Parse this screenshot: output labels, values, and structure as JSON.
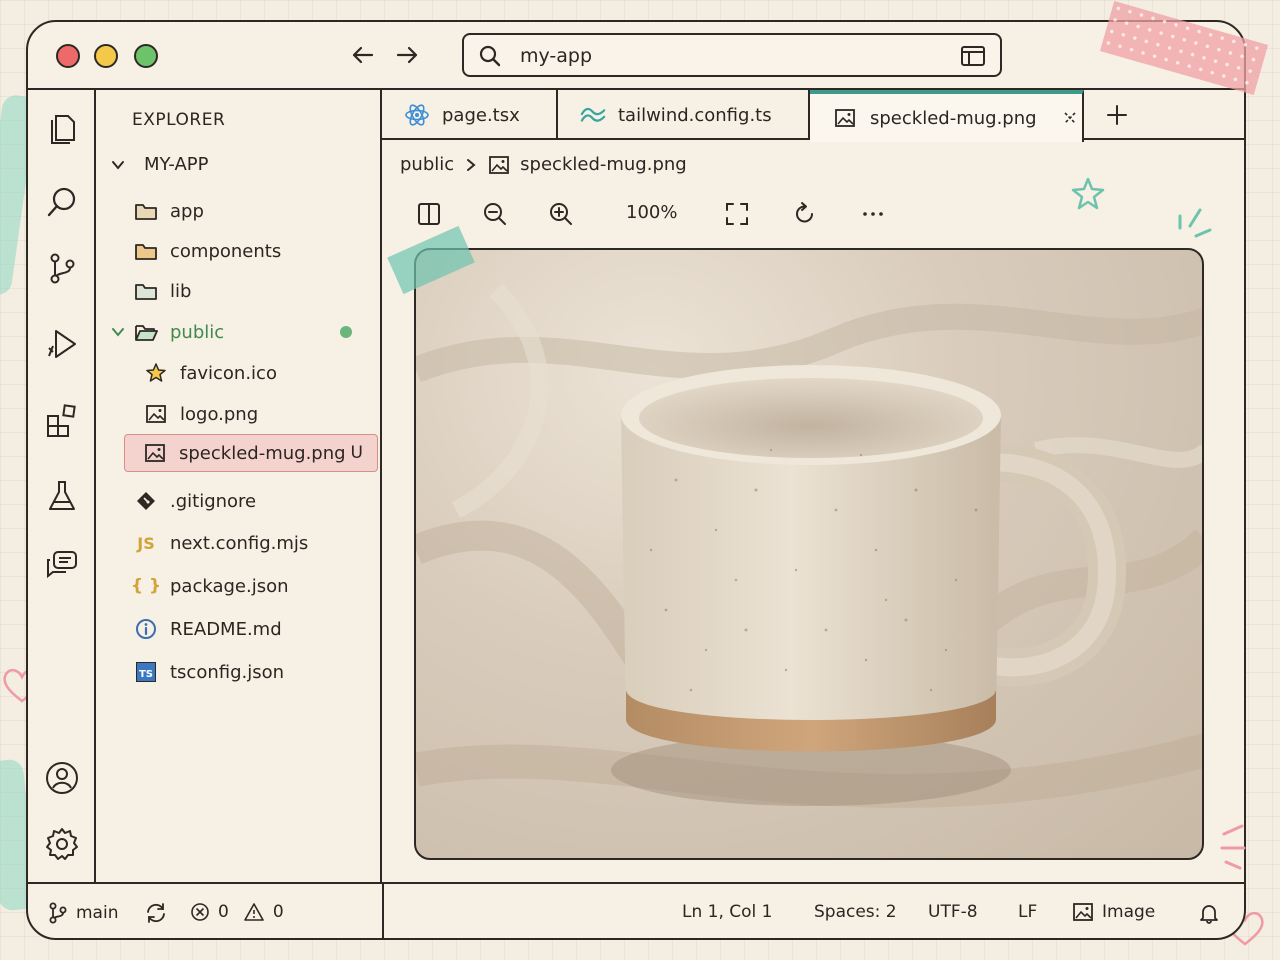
{
  "window": {
    "search": {
      "value": "my-app"
    }
  },
  "sidebar": {
    "title": "EXPLORER",
    "root": "MY-APP",
    "items": [
      {
        "label": "app",
        "icon": "folder-icon"
      },
      {
        "label": "components",
        "icon": "folder-icon"
      },
      {
        "label": "lib",
        "icon": "folder-icon"
      },
      {
        "label": "public",
        "icon": "folder-open-icon"
      },
      {
        "label": "favicon.ico",
        "icon": "star-icon"
      },
      {
        "label": "logo.png",
        "icon": "image-icon"
      },
      {
        "label": "speckled-mug.png",
        "icon": "image-icon",
        "badge": "U"
      },
      {
        "label": ".gitignore",
        "icon": "git-icon"
      },
      {
        "label": "next.config.mjs",
        "icon": "js-icon",
        "icon_text": "JS"
      },
      {
        "label": "package.json",
        "icon": "json-icon",
        "icon_text": "{ }"
      },
      {
        "label": "README.md",
        "icon": "info-icon"
      },
      {
        "label": "tsconfig.json",
        "icon": "ts-icon",
        "icon_text": "TS"
      }
    ]
  },
  "tabs": [
    {
      "label": "page.tsx",
      "icon": "react-icon"
    },
    {
      "label": "tailwind.config.ts",
      "icon": "tailwind-icon"
    },
    {
      "label": "speckled-mug.png",
      "icon": "image-icon",
      "active": true
    }
  ],
  "breadcrumb": {
    "parent": "public",
    "file": "speckled-mug.png"
  },
  "image_toolbar": {
    "zoom": "100%"
  },
  "statusbar": {
    "branch": "main",
    "errors": "0",
    "warnings": "0",
    "position": "Ln 1, Col 1",
    "spaces": "Spaces: 2",
    "encoding": "UTF-8",
    "eol": "LF",
    "mode": "Image"
  },
  "colors": {
    "accent": "#3f9a8e",
    "modified": "#6ab57c",
    "selection": "#f4d3cf",
    "ink": "#2d2824"
  }
}
